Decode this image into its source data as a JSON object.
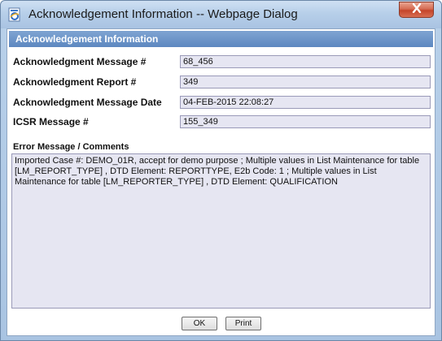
{
  "window": {
    "title": "Acknowledgement Information -- Webpage Dialog"
  },
  "section": {
    "title": "Acknowledgement Information"
  },
  "fields": [
    {
      "label": "Acknowledgment Message #",
      "value": "68_456"
    },
    {
      "label": "Acknowledgment Report #",
      "value": "349"
    },
    {
      "label": "Acknowledgment Message Date",
      "value": "04-FEB-2015 22:08:27"
    },
    {
      "label": "ICSR Message #",
      "value": "155_349"
    }
  ],
  "error": {
    "label": "Error Message / Comments",
    "text": "Imported Case #: DEMO_01R, accept for demo purpose ; Multiple values in List Maintenance for table [LM_REPORT_TYPE] , DTD Element: REPORTTYPE, E2b Code: 1 ; Multiple values in List Maintenance for table [LM_REPORTER_TYPE] , DTD Element: QUALIFICATION"
  },
  "buttons": {
    "ok": "OK",
    "print": "Print"
  },
  "icons": {
    "app": "ie-page-icon",
    "close": "close-icon"
  }
}
